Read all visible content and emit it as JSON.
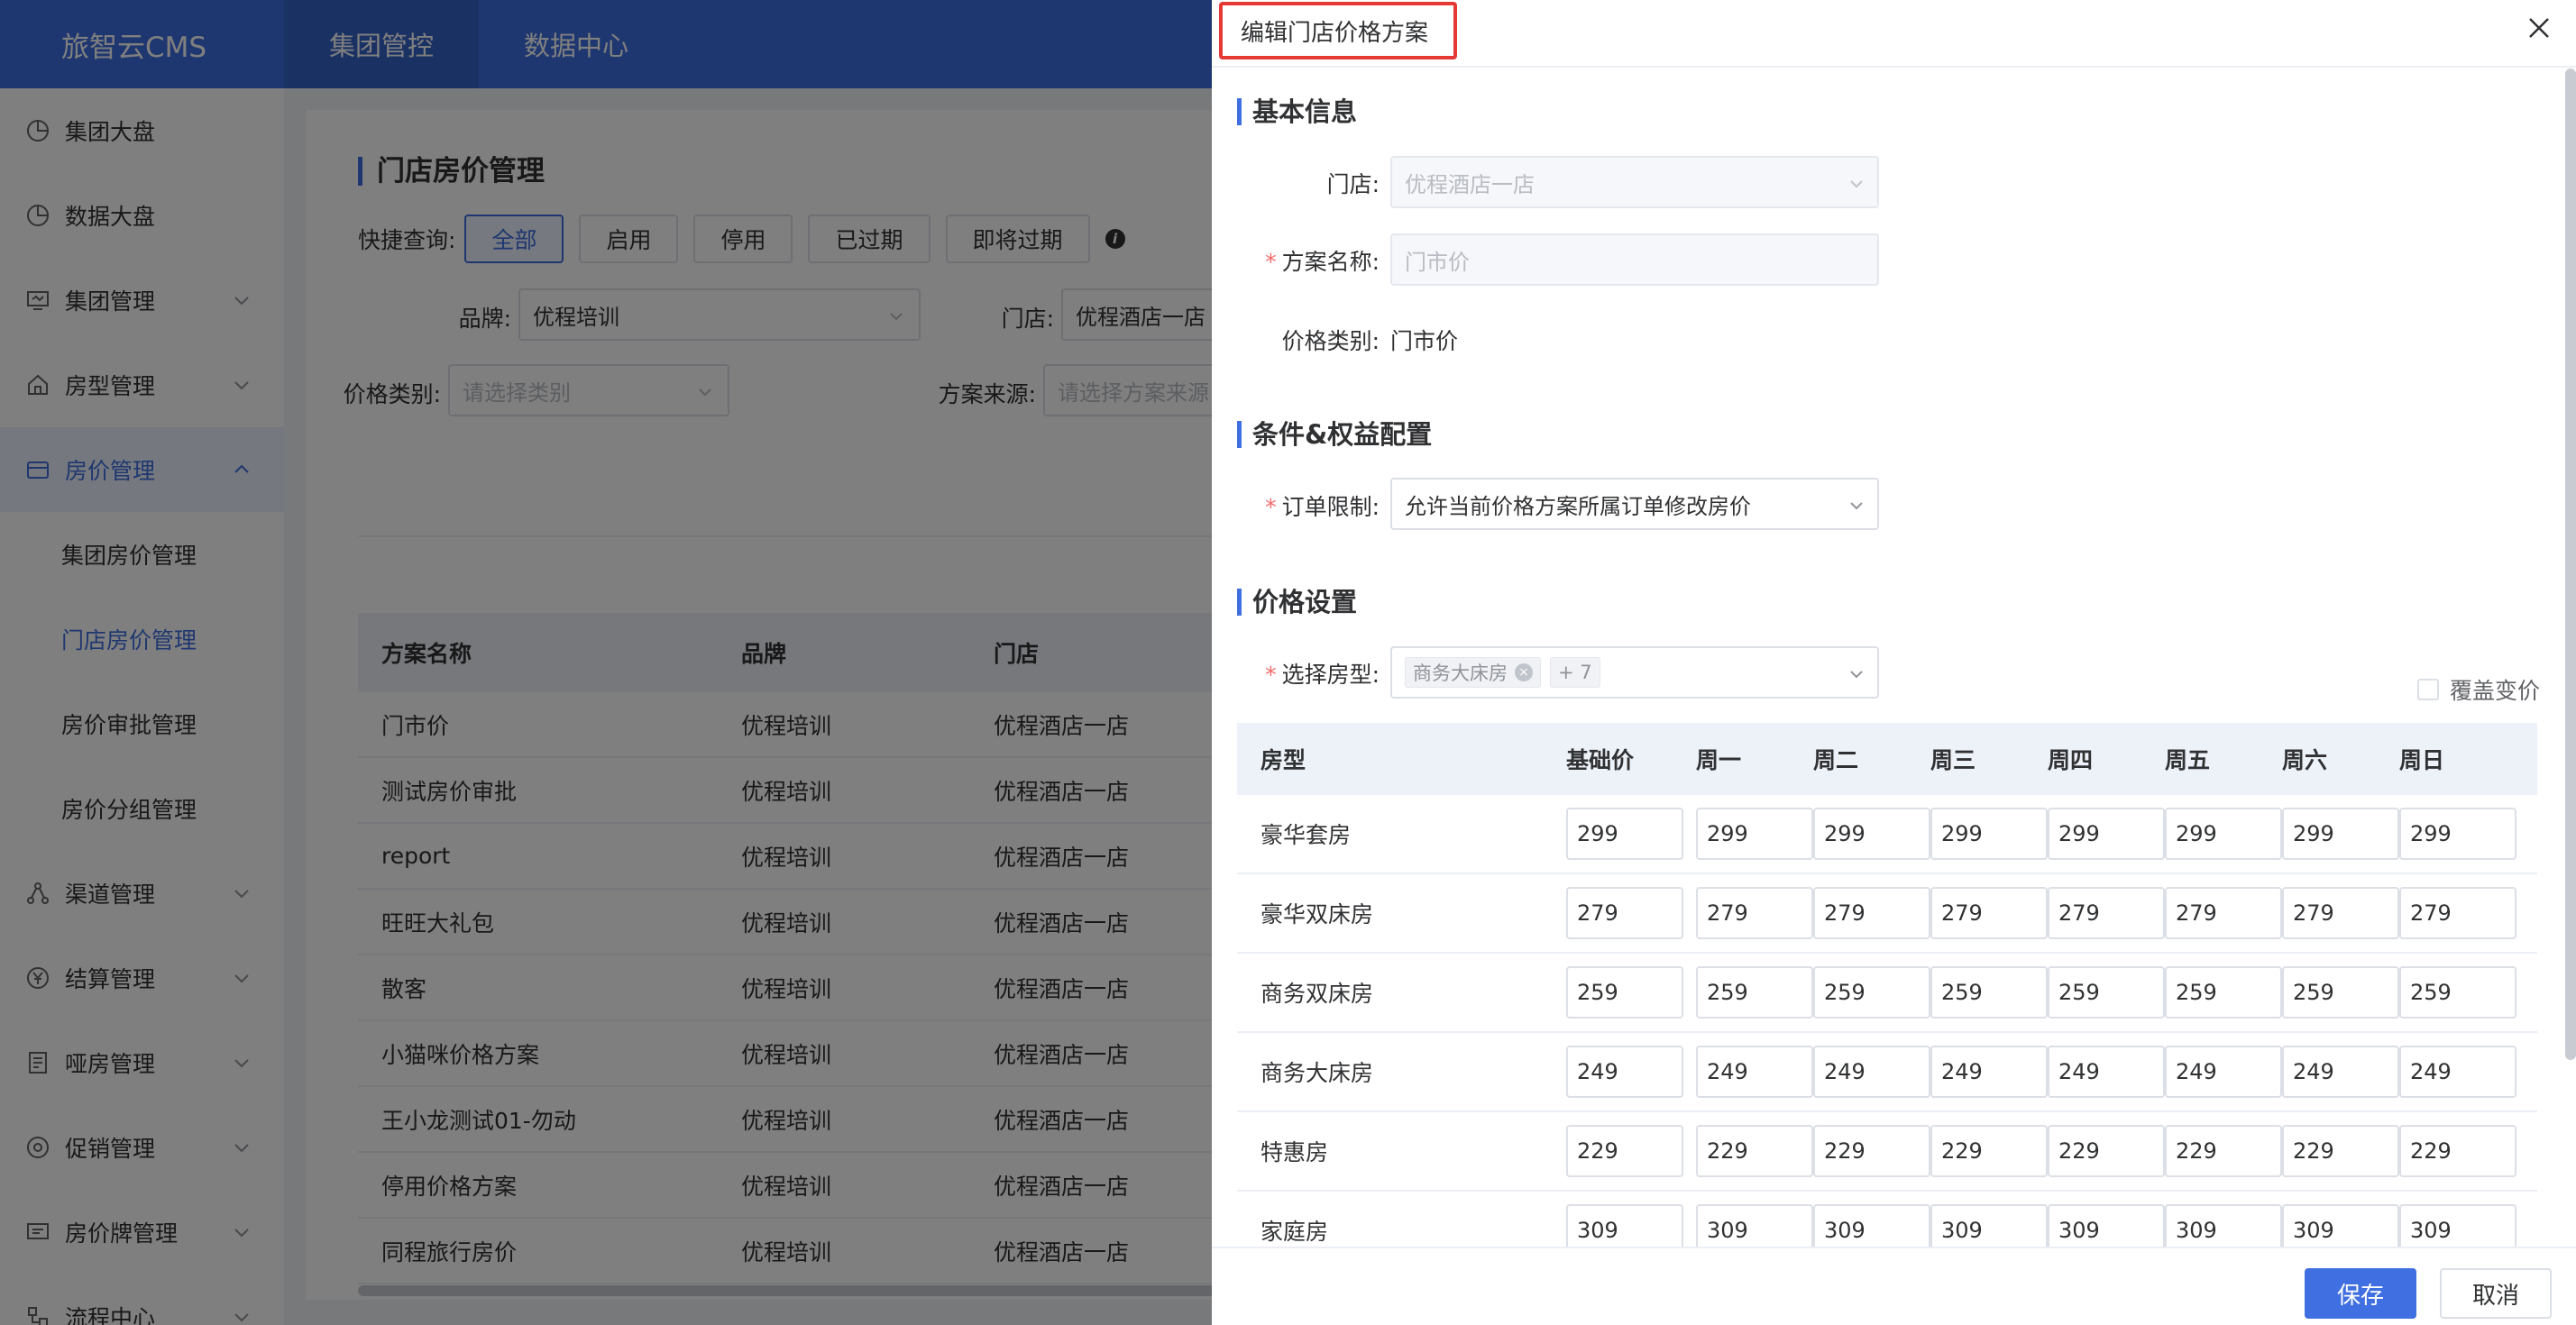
{
  "app": {
    "logo": "旅智云CMS"
  },
  "topnav": [
    {
      "label": "集团管控"
    },
    {
      "label": "数据中心"
    }
  ],
  "sidebar": {
    "items": [
      {
        "label": "集团大盘",
        "icon": "pie-chart-icon"
      },
      {
        "label": "数据大盘",
        "icon": "pie-chart-icon"
      },
      {
        "label": "集团管理",
        "icon": "monitor-icon"
      },
      {
        "label": "房型管理",
        "icon": "home-icon"
      },
      {
        "label": "房价管理",
        "icon": "wallet-icon"
      }
    ],
    "sub": [
      {
        "label": "集团房价管理"
      },
      {
        "label": "门店房价管理"
      },
      {
        "label": "房价审批管理"
      },
      {
        "label": "房价分组管理"
      }
    ],
    "items2": [
      {
        "label": "渠道管理",
        "icon": "share-icon"
      },
      {
        "label": "结算管理",
        "icon": "yen-icon"
      },
      {
        "label": "哑房管理",
        "icon": "document-icon"
      },
      {
        "label": "促销管理",
        "icon": "gift-icon"
      },
      {
        "label": "房价牌管理",
        "icon": "display-icon"
      },
      {
        "label": "流程中心",
        "icon": "flow-icon"
      }
    ]
  },
  "page": {
    "title": "门店房价管理",
    "quick_label": "快捷查询:",
    "quick": [
      "全部",
      "启用",
      "停用",
      "已过期",
      "即将过期"
    ],
    "filters": {
      "brand_label": "品牌:",
      "brand_value": "优程培训",
      "store_label": "门店:",
      "store_value": "优程酒店一店",
      "category_label": "价格类别:",
      "category_placeholder": "请选择类别",
      "source_label": "方案来源:",
      "source_placeholder": "请选择方案来源"
    },
    "table": {
      "headers": [
        "方案名称",
        "品牌",
        "门店"
      ],
      "rows": [
        [
          "门市价",
          "优程培训",
          "优程酒店一店"
        ],
        [
          "测试房价审批",
          "优程培训",
          "优程酒店一店"
        ],
        [
          "report",
          "优程培训",
          "优程酒店一店"
        ],
        [
          "旺旺大礼包",
          "优程培训",
          "优程酒店一店"
        ],
        [
          "散客",
          "优程培训",
          "优程酒店一店"
        ],
        [
          "小猫咪价格方案",
          "优程培训",
          "优程酒店一店"
        ],
        [
          "王小龙测试01-勿动",
          "优程培训",
          "优程酒店一店"
        ],
        [
          "停用价格方案",
          "优程培训",
          "优程酒店一店"
        ],
        [
          "同程旅行房价",
          "优程培训",
          "优程酒店一店"
        ]
      ]
    }
  },
  "drawer": {
    "title": "编辑门店价格方案",
    "basic": {
      "section": "基本信息",
      "store_label": "门店:",
      "store_value": "优程酒店一店",
      "name_label": "方案名称:",
      "name_placeholder": "门市价",
      "category_label": "价格类别:",
      "category_value": "门市价"
    },
    "conditions": {
      "section": "条件&权益配置",
      "order_label": "订单限制:",
      "order_value": "允许当前价格方案所属订单修改房价"
    },
    "price": {
      "section": "价格设置",
      "room_label": "选择房型:",
      "room_tag": "商务大床房",
      "room_more": "+ 7",
      "cover_label": "覆盖变价",
      "headers": [
        "房型",
        "基础价",
        "周一",
        "周二",
        "周三",
        "周四",
        "周五",
        "周六",
        "周日"
      ],
      "rows": [
        {
          "name": "豪华套房",
          "v": [
            "299",
            "299",
            "299",
            "299",
            "299",
            "299",
            "299",
            "299"
          ]
        },
        {
          "name": "豪华双床房",
          "v": [
            "279",
            "279",
            "279",
            "279",
            "279",
            "279",
            "279",
            "279"
          ]
        },
        {
          "name": "商务双床房",
          "v": [
            "259",
            "259",
            "259",
            "259",
            "259",
            "259",
            "259",
            "259"
          ]
        },
        {
          "name": "商务大床房",
          "v": [
            "249",
            "249",
            "249",
            "249",
            "249",
            "249",
            "249",
            "249"
          ]
        },
        {
          "name": "特惠房",
          "v": [
            "229",
            "229",
            "229",
            "229",
            "229",
            "229",
            "229",
            "229"
          ]
        },
        {
          "name": "家庭房",
          "v": [
            "309",
            "309",
            "309",
            "309",
            "309",
            "309",
            "309",
            "309"
          ]
        }
      ]
    },
    "footer": {
      "save": "保存",
      "cancel": "取消"
    }
  },
  "colors": {
    "primary": "#3f6fe0",
    "required": "#f56c6c",
    "highlight_border": "#e53935"
  }
}
